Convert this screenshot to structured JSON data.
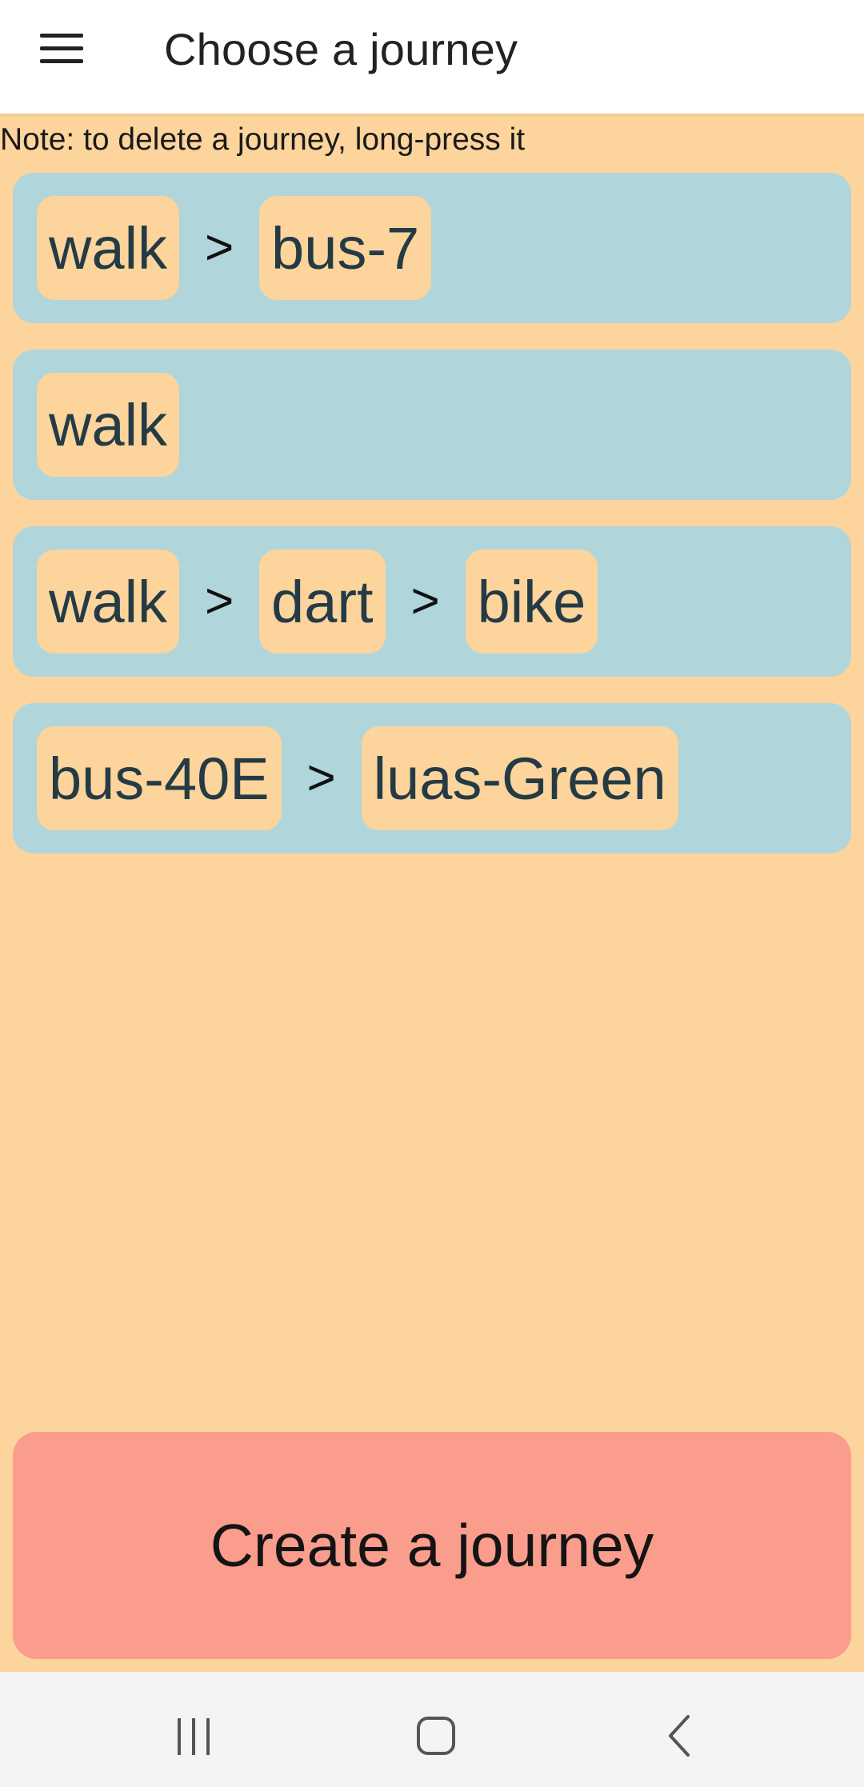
{
  "appbar": {
    "title": "Choose a journey",
    "menu_icon": "hamburger-menu-icon"
  },
  "note": "Note: to delete a journey, long-press it",
  "journeys": [
    {
      "legs": [
        "walk",
        "bus-7"
      ]
    },
    {
      "legs": [
        "walk"
      ]
    },
    {
      "legs": [
        "walk",
        "dart",
        "bike"
      ]
    },
    {
      "legs": [
        "bus-40E",
        "luas-Green"
      ]
    }
  ],
  "separator": ">",
  "create_button": {
    "label": "Create a journey"
  },
  "navbar": {
    "icons": [
      "recent-apps-icon",
      "home-icon",
      "back-icon"
    ]
  },
  "colors": {
    "background": "#fcd49c",
    "journey_card": "#b0d6dc",
    "chip": "#fcd49c",
    "create_button": "#fb9d8c",
    "appbar": "#ffffff"
  }
}
